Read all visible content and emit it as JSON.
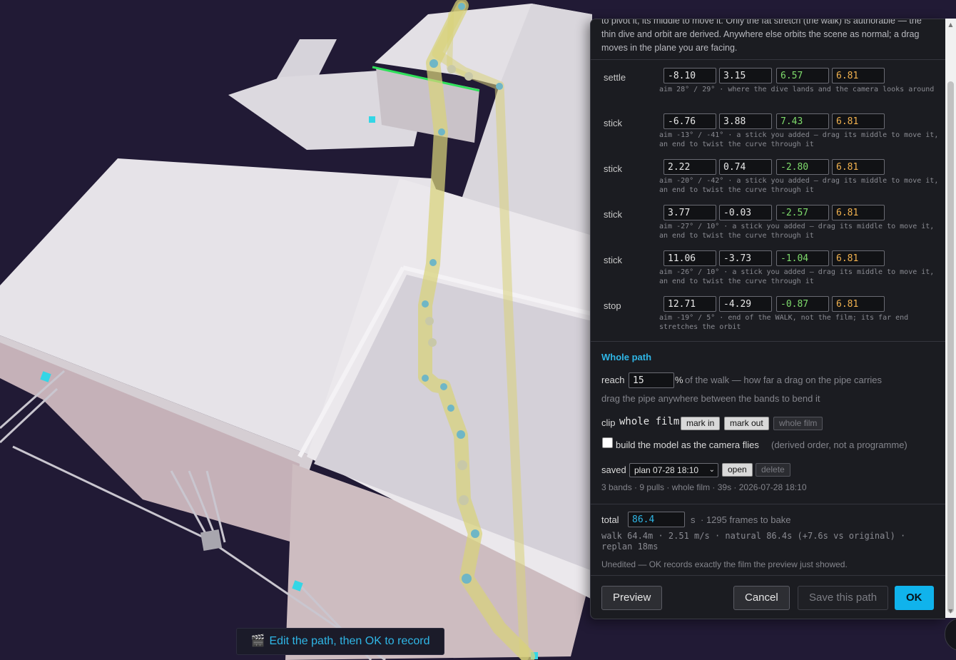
{
  "intro": "to pivot it, its middle to move it. Only the fat stretch (the walk) is authorable — the thin dive and orbit are derived. Anywhere else orbits the scene as normal; a drag moves in the plane you are facing.",
  "points": [
    {
      "name": "settle",
      "values": [
        "-8.10",
        "3.15",
        "6.57",
        "6.81"
      ],
      "desc": "aim 28° / 29° · where the dive lands and the camera looks around"
    },
    {
      "name": "stick",
      "values": [
        "-6.76",
        "3.88",
        "7.43",
        "6.81"
      ],
      "desc": "aim -13° / -41° · a stick you added — drag its middle to move it, an end to twist the curve through it"
    },
    {
      "name": "stick",
      "values": [
        "2.22",
        "0.74",
        "-2.80",
        "6.81"
      ],
      "desc": "aim -20° / -42° · a stick you added — drag its middle to move it, an end to twist the curve through it"
    },
    {
      "name": "stick",
      "values": [
        "3.77",
        "-0.03",
        "-2.57",
        "6.81"
      ],
      "desc": "aim -27° / 10° · a stick you added — drag its middle to move it, an end to twist the curve through it"
    },
    {
      "name": "stick",
      "values": [
        "11.06",
        "-3.73",
        "-1.04",
        "6.81"
      ],
      "desc": "aim -26° / 10° · a stick you added — drag its middle to move it, an end to twist the curve through it"
    },
    {
      "name": "stop",
      "values": [
        "12.71",
        "-4.29",
        "-0.87",
        "6.81"
      ],
      "desc": "aim -19° / 5° · end of the WALK, not the film; its far end stretches the orbit"
    }
  ],
  "whole_path": {
    "title": "Whole path",
    "reach_label": "reach",
    "reach_value": "15",
    "reach_unit": "%",
    "reach_hint": "of the walk — how far a drag on the pipe carries",
    "drag_hint": "drag the pipe anywhere between the bands to bend it",
    "clip_label": "clip",
    "clip_value": "whole film",
    "mark_in": "mark in",
    "mark_out": "mark out",
    "whole_film": "whole film",
    "build_label": "build the model as the camera flies",
    "build_hint": "(derived order, not a programme)",
    "build_checked": false,
    "saved_label": "saved",
    "saved_selected": "plan 07-28 18:10",
    "open": "open",
    "delete": "delete",
    "saved_info": "3 bands · 9 pulls · whole film · 39s · 2026-07-28 18:10"
  },
  "total": {
    "label": "total",
    "value": "86.4",
    "unit": "s",
    "frames": "· 1295 frames to bake",
    "stats": "walk 64.4m · 2.51 m/s · natural 86.4s (+7.6s vs original) · replan 18ms",
    "status": "Unedited — OK records exactly the film the preview just showed."
  },
  "buttons": {
    "preview": "Preview",
    "cancel": "Cancel",
    "save_path": "Save this path",
    "ok": "OK"
  },
  "toast": {
    "icon": "clapper-icon",
    "text": "Edit the path, then OK to record"
  },
  "colors": {
    "accent": "#2fb6e6",
    "primary_button": "#10b3ec",
    "y_value": "#7fdc6c",
    "height_value": "#f2b24f",
    "path": "#d8d27a",
    "background": "#211a35"
  }
}
